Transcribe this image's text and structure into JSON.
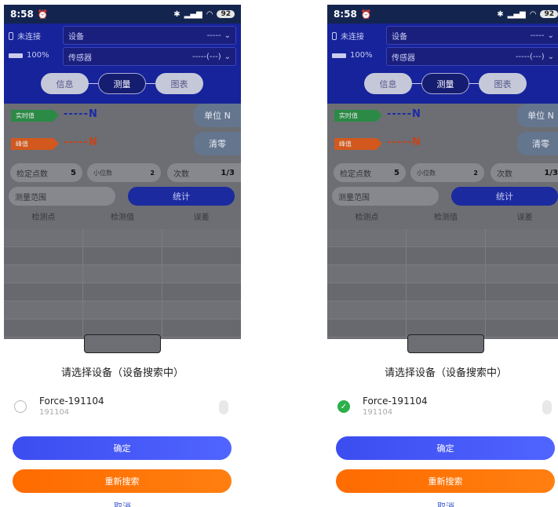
{
  "screens": [
    {
      "status": {
        "time": "8:58",
        "battery": "92"
      },
      "header": {
        "connection": "未连接",
        "device_label": "设备",
        "device_value": "-----",
        "battery_level": "100%",
        "sensor_label": "传感器",
        "sensor_value": "-----(---)"
      },
      "tabs": [
        "信息",
        "测量",
        "图表"
      ],
      "measure": {
        "realtime_tag": "实时值",
        "realtime_reading": "-----N",
        "peak_tag": "峰值",
        "peak_reading": "-----N",
        "unit_button": "单位 N",
        "zero_button": "清零",
        "points_label": "检定点数",
        "points_value": "5",
        "decimals_label": "小位数",
        "decimals_value": "2",
        "times_label": "次数",
        "times_value": "1/3",
        "range_label": "测量范围",
        "stats_button": "统计",
        "columns": [
          "检测点",
          "检测值",
          "误差"
        ]
      },
      "dialog": {
        "title": "请选择设备（设备搜索中）",
        "device_name": "Force-191104",
        "device_id": "191104",
        "selected": false,
        "confirm": "确定",
        "rescan": "重新搜索",
        "cancel": "取消"
      }
    },
    {
      "status": {
        "time": "8:58",
        "battery": "92"
      },
      "header": {
        "connection": "未连接",
        "device_label": "设备",
        "device_value": "-----",
        "battery_level": "100%",
        "sensor_label": "传感器",
        "sensor_value": "-----(---)"
      },
      "tabs": [
        "信息",
        "测量",
        "图表"
      ],
      "measure": {
        "realtime_tag": "实时值",
        "realtime_reading": "-----N",
        "peak_tag": "峰值",
        "peak_reading": "-----N",
        "unit_button": "单位 N",
        "zero_button": "清零",
        "points_label": "检定点数",
        "points_value": "5",
        "decimals_label": "小位数",
        "decimals_value": "2",
        "times_label": "次数",
        "times_value": "1/3",
        "range_label": "测量范围",
        "stats_button": "统计",
        "columns": [
          "检测点",
          "检测值",
          "误差"
        ]
      },
      "dialog": {
        "title": "请选择设备（设备搜索中）",
        "device_name": "Force-191104",
        "device_id": "191104",
        "selected": true,
        "confirm": "确定",
        "rescan": "重新搜索",
        "cancel": "取消"
      }
    }
  ]
}
